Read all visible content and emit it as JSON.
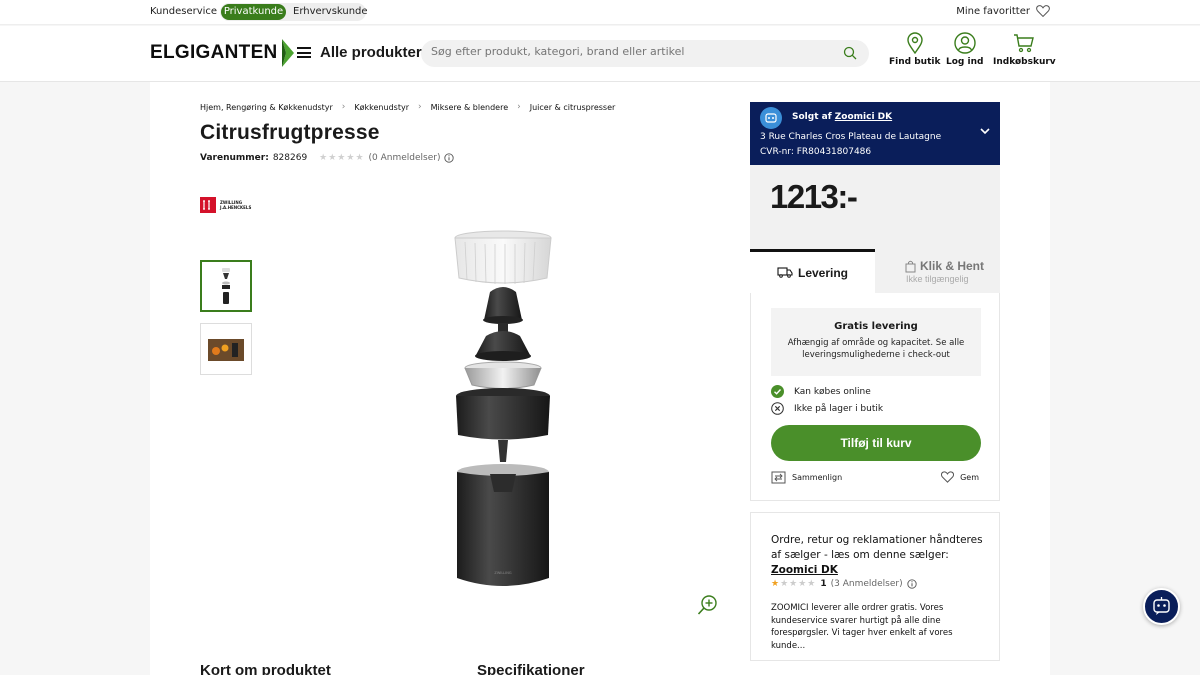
{
  "topbar": {
    "kundeservice": "Kundeservice",
    "privat": "Privatkunde",
    "erhverv": "Erhvervskunde",
    "favorites": "Mine favoritter"
  },
  "header": {
    "logo": "ELGIGANTEN",
    "all_products": "Alle produkter",
    "search_placeholder": "Søg efter produkt, kategori, brand eller artikel",
    "find_store": "Find butik",
    "login": "Log ind",
    "cart": "Indkøbskurv"
  },
  "breadcrumbs": [
    "Hjem, Rengøring & Køkkenudstyr",
    "Køkkenudstyr",
    "Miksere & blendere",
    "Juicer & citruspresser"
  ],
  "product": {
    "title": "Citrusfrugtpresse",
    "sku_label": "Varenummer:",
    "sku": "828269",
    "stars": "★★★★★",
    "reviews": "(0 Anmeldelser)",
    "brand": "ZWILLING J.A.HENCKELS",
    "section_about": "Kort om produktet",
    "section_specs": "Specifikationer"
  },
  "seller": {
    "sold_by": "Solgt af",
    "name": "Zoomici DK",
    "address": "3 Rue Charles Cros Plateau de Lautagne",
    "cvr": "CVR-nr: FR80431807486"
  },
  "price": "1213:-",
  "delivery": {
    "tab_delivery": "Levering",
    "tab_click": "Klik & Hent",
    "tab_click_sub": "Ikke tilgængelig",
    "free_title": "Gratis levering",
    "free_text": "Afhængig af område og kapacitet. Se alle leveringsmulighederne i check-out",
    "online": "Kan købes online",
    "not_in_store": "Ikke på lager i butik",
    "add_to_cart": "Tilføj til kurv",
    "compare": "Sammenlign",
    "save": "Gem"
  },
  "seller_info": {
    "text": "Ordre, retur og reklamationer håndteres af sælger - læs om denne sælger:",
    "link": "Zoomici DK",
    "rating_stars": "★★★★★",
    "rating": "1",
    "rating_count": "(3 Anmeldelser)",
    "description": "ZOOMICI leverer alle ordrer gratis. Vores kundeservice svarer hurtigt på alle dine forespørgsler. Vi tager hver enkelt af vores kunde..."
  },
  "colors": {
    "brand_green": "#3a7d1c",
    "button_green": "#4a8f2a",
    "navy": "#0a1e5a"
  }
}
